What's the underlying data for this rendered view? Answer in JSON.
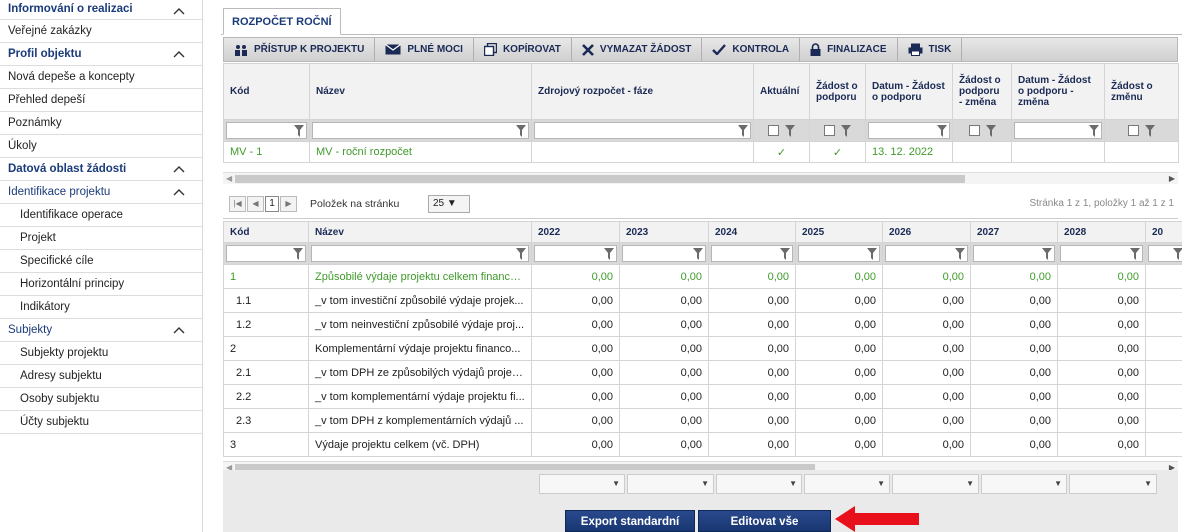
{
  "sidebar": {
    "items": [
      {
        "label": "Informování o realizaci",
        "kind": "section",
        "chevron": true
      },
      {
        "label": "Veřejné zakázky",
        "kind": "item"
      },
      {
        "label": "Profil objektu",
        "kind": "section",
        "chevron": true
      },
      {
        "label": "Nová depeše a koncepty",
        "kind": "item"
      },
      {
        "label": "Přehled depeší",
        "kind": "item"
      },
      {
        "label": "Poznámky",
        "kind": "item"
      },
      {
        "label": "Úkoly",
        "kind": "item"
      },
      {
        "label": "Datová oblast žádosti",
        "kind": "section",
        "chevron": true
      },
      {
        "label": "Identifikace projektu",
        "kind": "section-plain",
        "chevron": true
      },
      {
        "label": "Identifikace operace",
        "kind": "sub"
      },
      {
        "label": "Projekt",
        "kind": "sub"
      },
      {
        "label": "Specifické cíle",
        "kind": "sub"
      },
      {
        "label": "Horizontální principy",
        "kind": "sub"
      },
      {
        "label": "Indikátory",
        "kind": "sub"
      },
      {
        "label": "Subjekty",
        "kind": "section-plain",
        "chevron": true
      },
      {
        "label": "Subjekty projektu",
        "kind": "sub"
      },
      {
        "label": "Adresy subjektu",
        "kind": "sub"
      },
      {
        "label": "Osoby subjektu",
        "kind": "sub"
      },
      {
        "label": "Účty subjektu",
        "kind": "sub"
      }
    ]
  },
  "tab": {
    "label": "ROZPOČET ROČNÍ"
  },
  "toolbar": {
    "buttons": [
      {
        "label": "PŘÍSTUP K PROJEKTU",
        "icon": "people-icon"
      },
      {
        "label": "PLNÉ MOCI",
        "icon": "envelope-icon"
      },
      {
        "label": "KOPÍROVAT",
        "icon": "copy-icon"
      },
      {
        "label": "VYMAZAT ŽÁDOST",
        "icon": "delete-x-icon"
      },
      {
        "label": "KONTROLA",
        "icon": "checkmark-icon"
      },
      {
        "label": "FINALIZACE",
        "icon": "lock-icon"
      },
      {
        "label": "TISK",
        "icon": "printer-icon"
      }
    ]
  },
  "grid1": {
    "headers": [
      "Kód",
      "Název",
      "Zdrojový rozpočet - fáze",
      "Aktuální",
      "Žádost o podporu",
      "Datum - Žádost o podporu",
      "Žádost o podporu - změna",
      "Datum - Žádost o podporu - změna",
      "Žádost o změnu"
    ],
    "rows": [
      {
        "kod": "MV - 1",
        "nazev": "MV - roční rozpočet",
        "zdroj": "",
        "aktualni": "✓",
        "zadost": "✓",
        "datum": "13. 12. 2022",
        "zmena": "",
        "datum_zmena": "",
        "zadost_zmenu": ""
      }
    ]
  },
  "pager": {
    "first": "|◀",
    "prev": "◀",
    "page": "1",
    "next": "▶",
    "last": "▶|",
    "label": "Položek na stránku",
    "per_page": "25",
    "info": "Stránka 1 z 1, položky 1 až 1 z 1"
  },
  "grid2": {
    "headers": [
      "Kód",
      "Název",
      "2022",
      "2023",
      "2024",
      "2025",
      "2026",
      "2027",
      "2028",
      "20"
    ],
    "rows": [
      {
        "kod": "1",
        "nazev": "Způsobilé výdaje projektu celkem financo...",
        "values": [
          "0,00",
          "0,00",
          "0,00",
          "0,00",
          "0,00",
          "0,00",
          "0,00"
        ],
        "selected": true
      },
      {
        "kod": "1.1",
        "nazev": "_v tom investiční způsobilé výdaje projek...",
        "values": [
          "0,00",
          "0,00",
          "0,00",
          "0,00",
          "0,00",
          "0,00",
          "0,00"
        ]
      },
      {
        "kod": "1.2",
        "nazev": "_v tom neinvestiční způsobilé výdaje proj...",
        "values": [
          "0,00",
          "0,00",
          "0,00",
          "0,00",
          "0,00",
          "0,00",
          "0,00"
        ]
      },
      {
        "kod": "2",
        "nazev": "Komplementární výdaje projektu financo...",
        "values": [
          "0,00",
          "0,00",
          "0,00",
          "0,00",
          "0,00",
          "0,00",
          "0,00"
        ]
      },
      {
        "kod": "2.1",
        "nazev": "_v tom DPH ze způsobilých výdajů projek...",
        "values": [
          "0,00",
          "0,00",
          "0,00",
          "0,00",
          "0,00",
          "0,00",
          "0,00"
        ]
      },
      {
        "kod": "2.2",
        "nazev": "_v tom komplementární výdaje projektu fi...",
        "values": [
          "0,00",
          "0,00",
          "0,00",
          "0,00",
          "0,00",
          "0,00",
          "0,00"
        ]
      },
      {
        "kod": "2.3",
        "nazev": "_v tom DPH z komplementárních výdajů ...",
        "values": [
          "0,00",
          "0,00",
          "0,00",
          "0,00",
          "0,00",
          "0,00",
          "0,00"
        ]
      },
      {
        "kod": "3",
        "nazev": "Výdaje projektu celkem (vč. DPH)",
        "values": [
          "0,00",
          "0,00",
          "0,00",
          "0,00",
          "0,00",
          "0,00",
          "0,00"
        ]
      }
    ]
  },
  "buttons": {
    "export": "Export standardní",
    "edit_all": "Editovat vše"
  },
  "colors": {
    "accent": "#1a3b7a",
    "green": "#3f9a2a",
    "arrow": "#e8101a"
  }
}
